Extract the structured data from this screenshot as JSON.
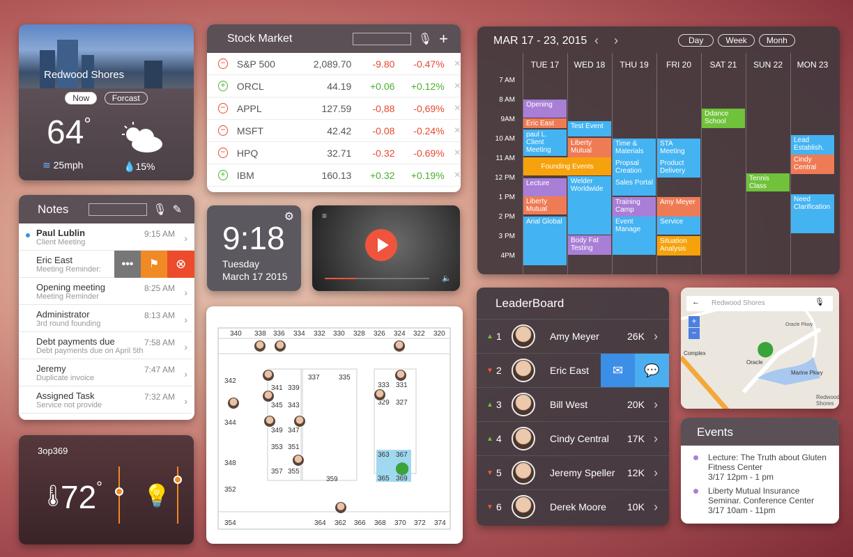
{
  "weather": {
    "city": "Redwood Shores",
    "tab_now": "Now",
    "tab_forecast": "Forcast",
    "temp": "64",
    "deg": "°",
    "wind": "25mph",
    "rain": "15%"
  },
  "stock": {
    "title": "Stock Market",
    "rows": [
      {
        "sign": "−",
        "name": "S&P 500",
        "price": "2,089.70",
        "chg": "-9.80",
        "pct": "-0.47%",
        "dir": "down"
      },
      {
        "sign": "+",
        "name": "ORCL",
        "price": "44.19",
        "chg": "+0.06",
        "pct": "+0.12%",
        "dir": "up"
      },
      {
        "sign": "−",
        "name": "APPL",
        "price": "127.59",
        "chg": "-0,88",
        "pct": "-0,69%",
        "dir": "down"
      },
      {
        "sign": "−",
        "name": "MSFT",
        "price": "42.42",
        "chg": "-0.08",
        "pct": "-0.24%",
        "dir": "down"
      },
      {
        "sign": "−",
        "name": "HPQ",
        "price": "32.71",
        "chg": "-0.32",
        "pct": "-0.69%",
        "dir": "down"
      },
      {
        "sign": "+",
        "name": "IBM",
        "price": "160.13",
        "chg": "+0.32",
        "pct": "+0.19%",
        "dir": "up"
      }
    ]
  },
  "notes": {
    "title": "Notes",
    "items": [
      {
        "title": "Paul Lublin",
        "sub": "Client Meeting",
        "time": "9:15 AM"
      },
      {
        "title": "Eric East",
        "sub": "Meeting Reminder:",
        "time": ""
      },
      {
        "title": "Opening meeting",
        "sub": "Meeting Reminder",
        "time": "8:25 AM"
      },
      {
        "title": "Administrator",
        "sub": "3rd round founding",
        "time": "8:13 AM"
      },
      {
        "title": "Debt payments due",
        "sub": "Debt payments due  on April 5th",
        "time": "7:58 AM"
      },
      {
        "title": "Jeremy",
        "sub": "Duplicate invoice",
        "time": "7:47 AM"
      },
      {
        "title": "Assigned Task",
        "sub": "Service not provide",
        "time": "7:32 AM"
      }
    ]
  },
  "clock": {
    "time": "9:18",
    "day": "Tuesday",
    "date": "March 17 2015"
  },
  "thermo": {
    "name": "3op369",
    "temp": "72",
    "deg": "°"
  },
  "calendar": {
    "title": "MAR 17 - 23, 2015",
    "view_day": "Day",
    "view_week": "Week",
    "view_month": "Monh",
    "days": [
      "TUE 17",
      "WED 18",
      "THU 19",
      "FRI 20",
      "SAT 21",
      "SUN 22",
      "MON 23"
    ],
    "hours": [
      "7 AM",
      "8 AM",
      "9AM",
      "10 AM",
      "11 AM",
      "12 PM",
      "1 PM",
      "2 PM",
      "3 PM",
      "4PM"
    ],
    "events": [
      "Opening",
      "Eric East",
      "paul L. Client Meeting",
      "Founding Events",
      "Lecture",
      "Liberty Mutual",
      "Arial Global",
      "Test Event",
      "Liberty Mutual",
      "Welder Worldwide",
      "Body Fat Testing",
      "Time & Materials",
      "Propsal Creation",
      "Sales Portal",
      "Training Camp",
      "Event Manage",
      "STA Meeting",
      "Product Delivery",
      "Amy Meyer",
      "Service",
      "Situation Analysis",
      "Ddance School",
      "Tennis Class",
      "Lead Establish.",
      "Cindy Central",
      "Need Clarification"
    ]
  },
  "leaderboard": {
    "title": "LeaderBoard",
    "rows": [
      {
        "rank": "1",
        "trend": "▲",
        "name": "Amy Meyer",
        "score": "26K"
      },
      {
        "rank": "2",
        "trend": "▼",
        "name": "Eric East",
        "score": ""
      },
      {
        "rank": "3",
        "trend": "▲",
        "name": "Bill West",
        "score": "20K"
      },
      {
        "rank": "4",
        "trend": "▲",
        "name": "Cindy Central",
        "score": "17K"
      },
      {
        "rank": "5",
        "trend": "▼",
        "name": "Jeremy Speller",
        "score": "12K"
      },
      {
        "rank": "6",
        "trend": "▼",
        "name": "Derek Moore",
        "score": "10K"
      }
    ]
  },
  "gmap": {
    "search": "Redwood Shores",
    "labels": [
      "Oracle",
      "Complex",
      "Marine Pkwy",
      "Redwood Shores",
      "Oracle Pkwy"
    ]
  },
  "events": {
    "title": "Events",
    "items": [
      {
        "line1": "Lecture: The Truth about Gluten",
        "line2": "Fitness Center",
        "line3": "3/17 12pm - 1 pm"
      },
      {
        "line1": "Liberty Mutual Insurance",
        "line2": "Seminar.  Conference Center",
        "line3": "3/17   10am - 11pm"
      }
    ]
  },
  "floor": {
    "rooms": [
      "340",
      "338",
      "336",
      "334",
      "332",
      "330",
      "328",
      "326",
      "324",
      "322",
      "320",
      "342",
      "341",
      "339",
      "337",
      "335",
      "333",
      "331",
      "345",
      "343",
      "329",
      "327",
      "344",
      "349",
      "347",
      "353",
      "351",
      "348",
      "363",
      "367",
      "357",
      "355",
      "359",
      "365",
      "369",
      "352",
      "354",
      "364",
      "362",
      "366",
      "368",
      "370",
      "372",
      "374"
    ]
  }
}
